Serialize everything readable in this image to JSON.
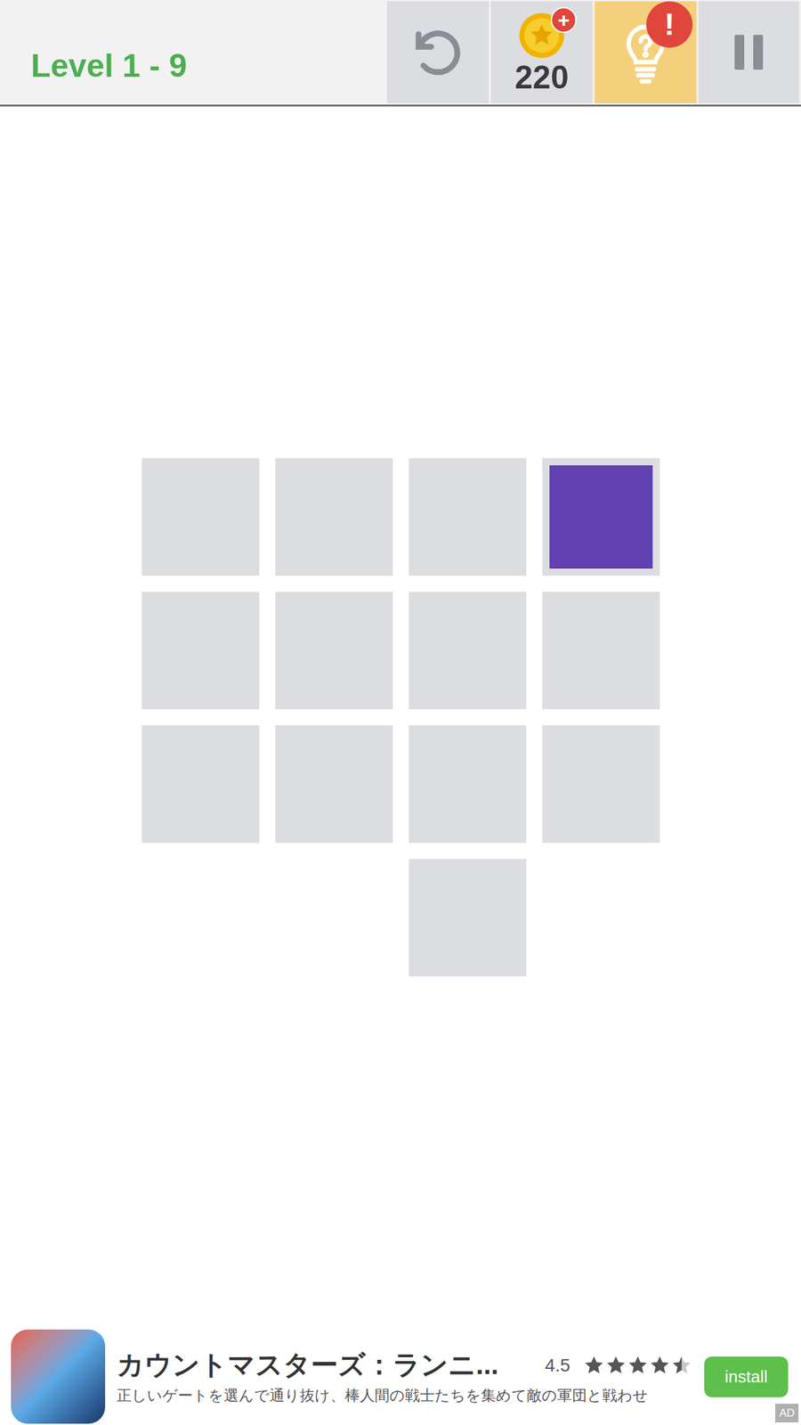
{
  "header": {
    "level_title": "Level 1 - 9",
    "coins": "220",
    "coin_badge": "+",
    "hint_badge": "!"
  },
  "board": {
    "rows": [
      [
        {
          "kind": "tile",
          "selected": false
        },
        {
          "kind": "tile",
          "selected": false
        },
        {
          "kind": "tile",
          "selected": false
        },
        {
          "kind": "tile",
          "selected": true
        }
      ],
      [
        {
          "kind": "tile",
          "selected": false
        },
        {
          "kind": "tile",
          "selected": false
        },
        {
          "kind": "tile",
          "selected": false
        },
        {
          "kind": "tile",
          "selected": false
        }
      ],
      [
        {
          "kind": "tile",
          "selected": false
        },
        {
          "kind": "tile",
          "selected": false
        },
        {
          "kind": "tile",
          "selected": false
        },
        {
          "kind": "tile",
          "selected": false
        }
      ],
      [
        {
          "kind": "empty",
          "selected": false
        },
        {
          "kind": "empty",
          "selected": false
        },
        {
          "kind": "tile",
          "selected": false
        },
        {
          "kind": "empty",
          "selected": false
        }
      ]
    ]
  },
  "ad": {
    "title": "カウントマスターズ：ランニ...",
    "rating": "4.5",
    "stars": 4.5,
    "subtitle": "正しいゲートを選んで通り抜け、棒人間の戦士たちを集めて敵の軍団と戦わせ",
    "button": "install",
    "tag": "AD"
  }
}
